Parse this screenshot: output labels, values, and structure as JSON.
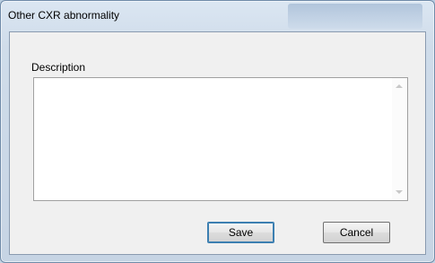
{
  "window": {
    "title": "Other CXR abnormality"
  },
  "form": {
    "description_label": "Description",
    "description_value": ""
  },
  "buttons": {
    "save_label": "Save",
    "cancel_label": "Cancel"
  },
  "colors": {
    "frame": "#c6d4e4",
    "client_bg": "#f0f0f0",
    "default_button_border": "#3c7fb1"
  }
}
